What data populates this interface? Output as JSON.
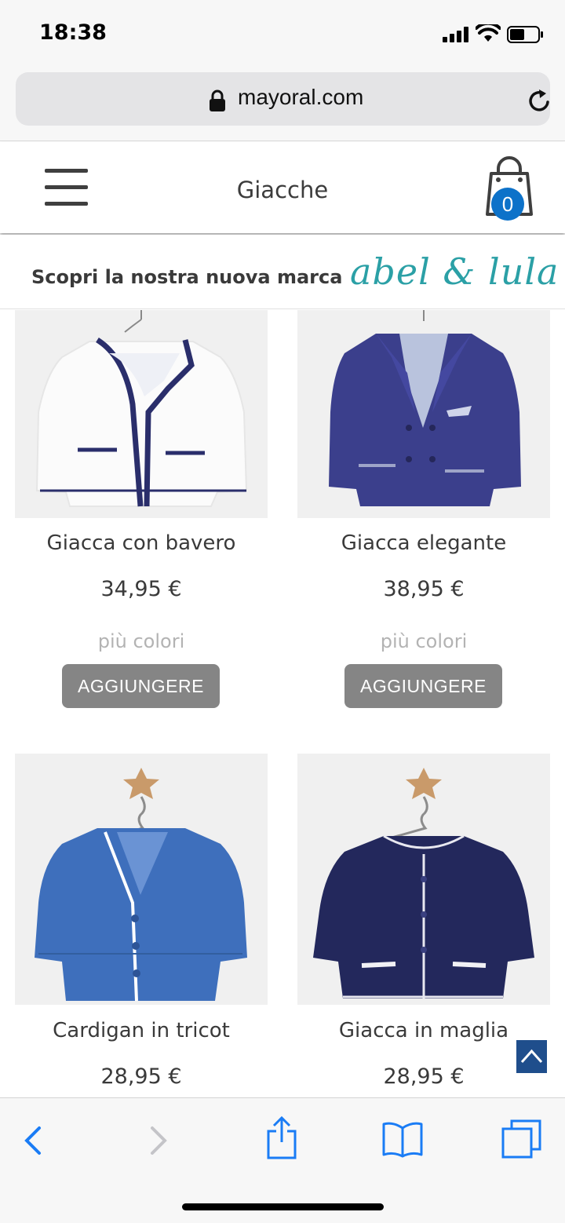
{
  "status": {
    "time": "18:38"
  },
  "browser": {
    "url": "mayoral.com"
  },
  "header": {
    "title": "Giacche",
    "cart_count": "0"
  },
  "promo": {
    "text": "Scopri la nostra nuova marca",
    "brand": "abel & lula"
  },
  "products": [
    {
      "name": "Giacca con bavero",
      "price": "34,95 €",
      "colors": "più colori",
      "button": "AGGIUNGERE"
    },
    {
      "name": "Giacca elegante",
      "price": "38,95 €",
      "colors": "più colori",
      "button": "AGGIUNGERE"
    },
    {
      "name": "Cardigan in tricot",
      "price": "28,95 €"
    },
    {
      "name": "Giacca in maglia",
      "price": "28,95 €"
    }
  ],
  "colors": {
    "accent_blue": "#0d72c9",
    "button_gray": "#858585",
    "brand_teal": "#2ba0a6",
    "ios_blue": "#1a7cf5"
  },
  "icons": [
    "signal-icon",
    "wifi-icon",
    "battery-icon",
    "lock-icon",
    "reload-icon",
    "hamburger-menu-icon",
    "shopping-bag-icon",
    "back-to-top-icon",
    "back-icon",
    "forward-icon",
    "share-icon",
    "bookmarks-icon",
    "tabs-icon"
  ]
}
